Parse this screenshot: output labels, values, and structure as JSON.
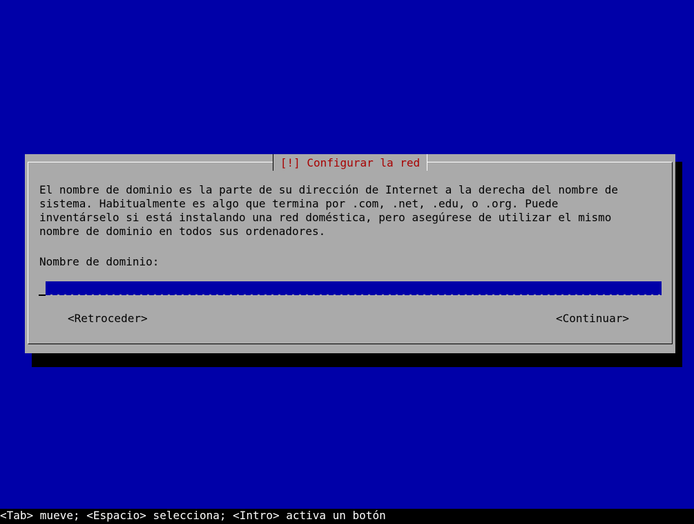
{
  "dialog": {
    "title": "[!] Configurar la red",
    "description": "El nombre de dominio es la parte de su dirección de Internet a la derecha del nombre de\nsistema. Habitualmente es algo que termina por .com, .net, .edu, o .org. Puede\ninventárselo si está instalando una red doméstica, pero asegúrese de utilizar el mismo\nnombre de dominio en todos sus ordenadores.",
    "field_label": "Nombre de dominio:",
    "field_value": "",
    "back_button": "<Retroceder>",
    "continue_button": "<Continuar>"
  },
  "statusbar": {
    "text": "<Tab> mueve; <Espacio> selecciona; <Intro> activa un botón"
  },
  "colors": {
    "background": "#0000a8",
    "dialog": "#aaaaaa",
    "title": "#a80000",
    "statusbar": "#000000"
  }
}
